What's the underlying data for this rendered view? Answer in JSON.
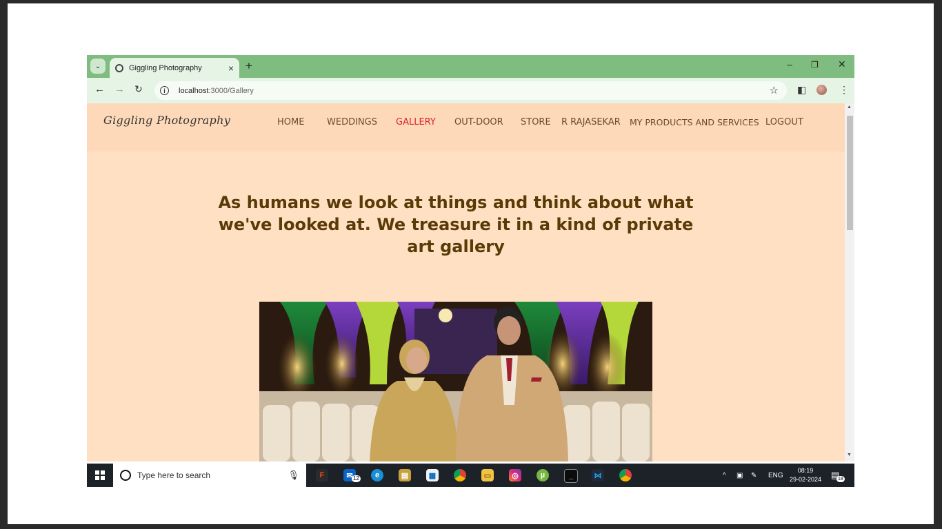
{
  "browser": {
    "tab_title": "Giggling Photography",
    "tab_close": "×",
    "new_tab": "+",
    "window_controls": {
      "minimize": "–",
      "restore": "❐",
      "close": "✕"
    },
    "url_host": "localhost",
    "url_path": ":3000/Gallery",
    "icons": [
      "tab-search-icon",
      "favicon-globe-icon",
      "back-arrow-icon",
      "forward-arrow-icon",
      "reload-icon",
      "site-info-icon",
      "bookmark-star-icon",
      "side-panel-icon",
      "profile-avatar",
      "menu-dots-icon"
    ]
  },
  "page": {
    "brand": "Giggling Photography",
    "nav": [
      {
        "label": "HOME"
      },
      {
        "label": "WEDDINGS"
      },
      {
        "label": "GALLERY",
        "active": true
      },
      {
        "label": "OUT-DOOR"
      },
      {
        "label": "STORE"
      },
      {
        "label": "R RAJASEKAR"
      },
      {
        "label": "MY PRODUCTS AND SERVICES"
      },
      {
        "label": "LOGOUT"
      }
    ],
    "quote": "As humans we look at things and think about what we've looked at. We treasure it in a kind of private art gallery",
    "photo_description": "wedding couple photo",
    "colors": {
      "navbar_bg": "#fdd9b9",
      "page_bg": "#ffe0c2",
      "nav_text": "#6b4b2f",
      "nav_active": "#d9232e",
      "quote_text": "#5a3a06",
      "tabstrip": "#7fbc7f"
    }
  },
  "taskbar": {
    "search_placeholder": "Type here to search",
    "mail_badge": "12",
    "tray_lang": "ENG",
    "time": "08:19",
    "date": "29-02-2024",
    "notification_count": "18",
    "apps": [
      "figma-icon",
      "mail-icon",
      "edge-icon",
      "notes-icon",
      "store-icon",
      "chrome-icon",
      "file-explorer-icon",
      "instagram-icon",
      "utorrent-icon",
      "terminal-icon",
      "vscode-icon",
      "chrome-profile-icon"
    ]
  }
}
